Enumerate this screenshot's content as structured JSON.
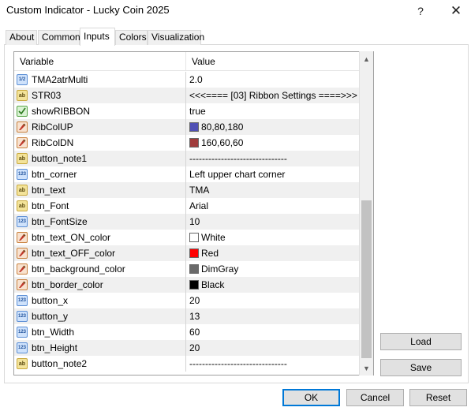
{
  "window": {
    "title": "Custom Indicator - Lucky Coin 2025",
    "help_glyph": "?",
    "close_glyph": "✕"
  },
  "tabs": [
    {
      "label": "About",
      "active": false
    },
    {
      "label": "Common",
      "active": false
    },
    {
      "label": "Inputs",
      "active": true
    },
    {
      "label": "Colors",
      "active": false
    },
    {
      "label": "Visualization",
      "active": false
    }
  ],
  "grid": {
    "col_variable": "Variable",
    "col_value": "Value",
    "rows": [
      {
        "icon": "float-icon",
        "name": "TMA2atrMulti",
        "value": "2.0"
      },
      {
        "icon": "string-icon",
        "name": "STR03",
        "value": "<<<==== [03] Ribbon Settings ====>>>"
      },
      {
        "icon": "bool-icon",
        "name": "showRIBBON",
        "value": "true"
      },
      {
        "icon": "color-icon",
        "name": "RibColUP",
        "value": "80,80,180",
        "swatch": "#5050b4"
      },
      {
        "icon": "color-icon",
        "name": "RibColDN",
        "value": "160,60,60",
        "swatch": "#a03c3c"
      },
      {
        "icon": "string-icon",
        "name": "button_note1",
        "value": "-------------------------------"
      },
      {
        "icon": "int-icon",
        "name": "btn_corner",
        "value": "Left upper chart corner"
      },
      {
        "icon": "string-icon",
        "name": "btn_text",
        "value": "TMA"
      },
      {
        "icon": "string-icon",
        "name": "btn_Font",
        "value": "Arial"
      },
      {
        "icon": "int-icon",
        "name": "btn_FontSize",
        "value": "10"
      },
      {
        "icon": "color-icon",
        "name": "btn_text_ON_color",
        "value": "White",
        "swatch": "#ffffff"
      },
      {
        "icon": "color-icon",
        "name": "btn_text_OFF_color",
        "value": "Red",
        "swatch": "#ff0000"
      },
      {
        "icon": "color-icon",
        "name": "btn_background_color",
        "value": "DimGray",
        "swatch": "#696969"
      },
      {
        "icon": "color-icon",
        "name": "btn_border_color",
        "value": "Black",
        "swatch": "#000000"
      },
      {
        "icon": "int-icon",
        "name": "button_x",
        "value": "20"
      },
      {
        "icon": "int-icon",
        "name": "button_y",
        "value": "13"
      },
      {
        "icon": "int-icon",
        "name": "btn_Width",
        "value": "60"
      },
      {
        "icon": "int-icon",
        "name": "btn_Height",
        "value": "20"
      },
      {
        "icon": "string-icon",
        "name": "button_note2",
        "value": "-------------------------------"
      }
    ]
  },
  "buttons": {
    "load": "Load",
    "save": "Save",
    "ok": "OK",
    "cancel": "Cancel",
    "reset": "Reset"
  },
  "colors": {
    "ok_border": "#0078d7",
    "row_alt": "#f0f0f0"
  }
}
